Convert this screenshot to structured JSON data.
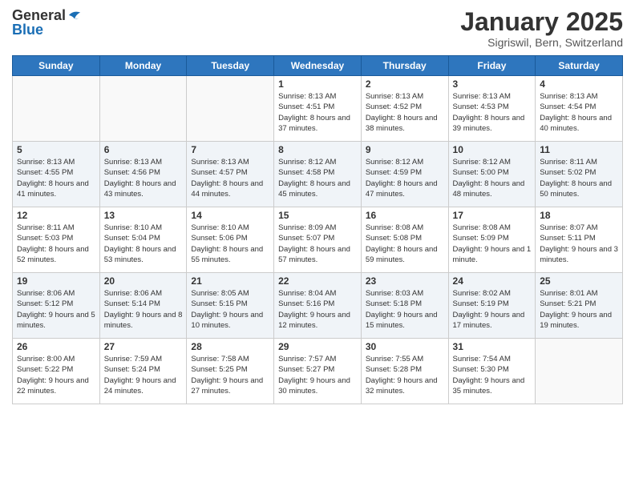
{
  "header": {
    "logo_general": "General",
    "logo_blue": "Blue",
    "title": "January 2025",
    "location": "Sigriswil, Bern, Switzerland"
  },
  "days_of_week": [
    "Sunday",
    "Monday",
    "Tuesday",
    "Wednesday",
    "Thursday",
    "Friday",
    "Saturday"
  ],
  "weeks": [
    [
      {
        "day": "",
        "info": ""
      },
      {
        "day": "",
        "info": ""
      },
      {
        "day": "",
        "info": ""
      },
      {
        "day": "1",
        "info": "Sunrise: 8:13 AM\nSunset: 4:51 PM\nDaylight: 8 hours and 37 minutes."
      },
      {
        "day": "2",
        "info": "Sunrise: 8:13 AM\nSunset: 4:52 PM\nDaylight: 8 hours and 38 minutes."
      },
      {
        "day": "3",
        "info": "Sunrise: 8:13 AM\nSunset: 4:53 PM\nDaylight: 8 hours and 39 minutes."
      },
      {
        "day": "4",
        "info": "Sunrise: 8:13 AM\nSunset: 4:54 PM\nDaylight: 8 hours and 40 minutes."
      }
    ],
    [
      {
        "day": "5",
        "info": "Sunrise: 8:13 AM\nSunset: 4:55 PM\nDaylight: 8 hours and 41 minutes."
      },
      {
        "day": "6",
        "info": "Sunrise: 8:13 AM\nSunset: 4:56 PM\nDaylight: 8 hours and 43 minutes."
      },
      {
        "day": "7",
        "info": "Sunrise: 8:13 AM\nSunset: 4:57 PM\nDaylight: 8 hours and 44 minutes."
      },
      {
        "day": "8",
        "info": "Sunrise: 8:12 AM\nSunset: 4:58 PM\nDaylight: 8 hours and 45 minutes."
      },
      {
        "day": "9",
        "info": "Sunrise: 8:12 AM\nSunset: 4:59 PM\nDaylight: 8 hours and 47 minutes."
      },
      {
        "day": "10",
        "info": "Sunrise: 8:12 AM\nSunset: 5:00 PM\nDaylight: 8 hours and 48 minutes."
      },
      {
        "day": "11",
        "info": "Sunrise: 8:11 AM\nSunset: 5:02 PM\nDaylight: 8 hours and 50 minutes."
      }
    ],
    [
      {
        "day": "12",
        "info": "Sunrise: 8:11 AM\nSunset: 5:03 PM\nDaylight: 8 hours and 52 minutes."
      },
      {
        "day": "13",
        "info": "Sunrise: 8:10 AM\nSunset: 5:04 PM\nDaylight: 8 hours and 53 minutes."
      },
      {
        "day": "14",
        "info": "Sunrise: 8:10 AM\nSunset: 5:06 PM\nDaylight: 8 hours and 55 minutes."
      },
      {
        "day": "15",
        "info": "Sunrise: 8:09 AM\nSunset: 5:07 PM\nDaylight: 8 hours and 57 minutes."
      },
      {
        "day": "16",
        "info": "Sunrise: 8:08 AM\nSunset: 5:08 PM\nDaylight: 8 hours and 59 minutes."
      },
      {
        "day": "17",
        "info": "Sunrise: 8:08 AM\nSunset: 5:09 PM\nDaylight: 9 hours and 1 minute."
      },
      {
        "day": "18",
        "info": "Sunrise: 8:07 AM\nSunset: 5:11 PM\nDaylight: 9 hours and 3 minutes."
      }
    ],
    [
      {
        "day": "19",
        "info": "Sunrise: 8:06 AM\nSunset: 5:12 PM\nDaylight: 9 hours and 5 minutes."
      },
      {
        "day": "20",
        "info": "Sunrise: 8:06 AM\nSunset: 5:14 PM\nDaylight: 9 hours and 8 minutes."
      },
      {
        "day": "21",
        "info": "Sunrise: 8:05 AM\nSunset: 5:15 PM\nDaylight: 9 hours and 10 minutes."
      },
      {
        "day": "22",
        "info": "Sunrise: 8:04 AM\nSunset: 5:16 PM\nDaylight: 9 hours and 12 minutes."
      },
      {
        "day": "23",
        "info": "Sunrise: 8:03 AM\nSunset: 5:18 PM\nDaylight: 9 hours and 15 minutes."
      },
      {
        "day": "24",
        "info": "Sunrise: 8:02 AM\nSunset: 5:19 PM\nDaylight: 9 hours and 17 minutes."
      },
      {
        "day": "25",
        "info": "Sunrise: 8:01 AM\nSunset: 5:21 PM\nDaylight: 9 hours and 19 minutes."
      }
    ],
    [
      {
        "day": "26",
        "info": "Sunrise: 8:00 AM\nSunset: 5:22 PM\nDaylight: 9 hours and 22 minutes."
      },
      {
        "day": "27",
        "info": "Sunrise: 7:59 AM\nSunset: 5:24 PM\nDaylight: 9 hours and 24 minutes."
      },
      {
        "day": "28",
        "info": "Sunrise: 7:58 AM\nSunset: 5:25 PM\nDaylight: 9 hours and 27 minutes."
      },
      {
        "day": "29",
        "info": "Sunrise: 7:57 AM\nSunset: 5:27 PM\nDaylight: 9 hours and 30 minutes."
      },
      {
        "day": "30",
        "info": "Sunrise: 7:55 AM\nSunset: 5:28 PM\nDaylight: 9 hours and 32 minutes."
      },
      {
        "day": "31",
        "info": "Sunrise: 7:54 AM\nSunset: 5:30 PM\nDaylight: 9 hours and 35 minutes."
      },
      {
        "day": "",
        "info": ""
      }
    ]
  ]
}
